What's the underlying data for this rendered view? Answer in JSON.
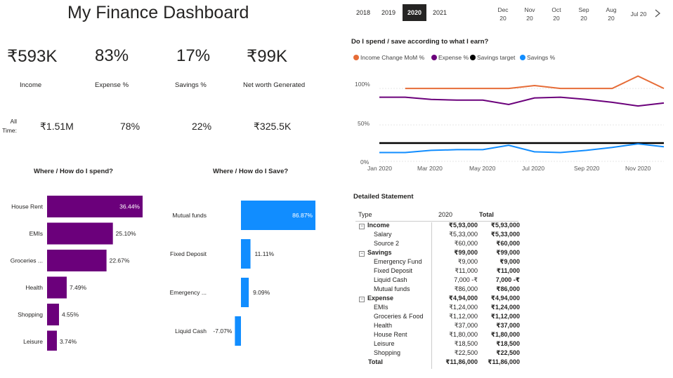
{
  "title": "My Finance Dashboard",
  "kpis": [
    {
      "value": "₹593K",
      "label": "Income",
      "all": "₹1.51M"
    },
    {
      "value": "83%",
      "label": "Expense %",
      "all": "78%"
    },
    {
      "value": "17%",
      "label": "Savings %",
      "all": "22%"
    },
    {
      "value": "₹99K",
      "label": "Net worth Generated",
      "all": "₹325.5K"
    }
  ],
  "all_time_label": "All Time:",
  "years": [
    "2018",
    "2019",
    "2020",
    "2021"
  ],
  "selected_year": "2020",
  "months": [
    {
      "m": "Dec",
      "y": "20"
    },
    {
      "m": "Nov",
      "y": "20"
    },
    {
      "m": "Oct",
      "y": "20"
    },
    {
      "m": "Sep",
      "y": "20"
    },
    {
      "m": "Aug",
      "y": "20"
    },
    {
      "m": "Jul 20",
      "y": ""
    }
  ],
  "chevron_icon": "chevron-right-icon",
  "spend_chart": {
    "title": "Where / How do I spend?",
    "color": "#6b007b"
  },
  "save_chart": {
    "title": "Where / How do I Save?",
    "color": "#118dff"
  },
  "line_chart": {
    "title": "Do I spend / save according to what I earn?",
    "legend": [
      {
        "name": "Income Change MoM %",
        "color": "#e66c37"
      },
      {
        "name": "Expense %",
        "color": "#6b007b"
      },
      {
        "name": "Savings target",
        "color": "#000000"
      },
      {
        "name": "Savings %",
        "color": "#118dff"
      }
    ],
    "y_ticks": [
      "100%",
      "50%",
      "0%"
    ],
    "x_ticks": [
      "Jan 2020",
      "Mar 2020",
      "May 2020",
      "Jul 2020",
      "Sep 2020",
      "Nov 2020"
    ]
  },
  "chart_data": [
    {
      "type": "bar",
      "title": "Where / How do I spend?",
      "categories": [
        "House Rent",
        "EMIs",
        "Groceries ...",
        "Health",
        "Shopping",
        "Leisure"
      ],
      "values": [
        36.44,
        25.1,
        22.67,
        7.49,
        4.55,
        3.74
      ],
      "labels": [
        "36.44%",
        "25.10%",
        "22.67%",
        "7.49%",
        "4.55%",
        "3.74%"
      ],
      "xlim": [
        0,
        36.44
      ]
    },
    {
      "type": "bar",
      "title": "Where / How do I Save?",
      "categories": [
        "Mutual funds",
        "Fixed Deposit",
        "Emergency ...",
        "Liquid Cash"
      ],
      "values": [
        86.87,
        11.11,
        9.09,
        -7.07
      ],
      "labels": [
        "86.87%",
        "11.11%",
        "9.09%",
        "-7.07%"
      ],
      "xlim": [
        -7.07,
        86.87
      ]
    },
    {
      "type": "line",
      "title": "Do I spend / save according to what I earn?",
      "x": [
        "Jan 2020",
        "Feb 2020",
        "Mar 2020",
        "Apr 2020",
        "May 2020",
        "Jun 2020",
        "Jul 2020",
        "Aug 2020",
        "Sep 2020",
        "Oct 2020",
        "Nov 2020",
        "Dec 2020"
      ],
      "ylim": [
        0,
        130
      ],
      "series": [
        {
          "name": "Income Change MoM %",
          "color": "#e66c37",
          "values": [
            null,
            100,
            100,
            100,
            100,
            100,
            104,
            100,
            100,
            100,
            117,
            100
          ]
        },
        {
          "name": "Expense %",
          "color": "#6b007b",
          "values": [
            88,
            88,
            85,
            84,
            84,
            78,
            87,
            88,
            85,
            81,
            76,
            80
          ]
        },
        {
          "name": "Savings target",
          "color": "#000000",
          "values": [
            25,
            25,
            25,
            25,
            25,
            25,
            25,
            25,
            25,
            25,
            25,
            25
          ]
        },
        {
          "name": "Savings %",
          "color": "#118dff",
          "values": [
            12,
            12,
            15,
            16,
            16,
            22,
            13,
            12,
            15,
            19,
            24,
            20
          ]
        }
      ]
    }
  ],
  "statement": {
    "title": "Detailed Statement",
    "headers": [
      "Type",
      "2020",
      "Total"
    ],
    "rows": [
      {
        "label": "Income",
        "level": 0,
        "v2020": "₹5,93,000",
        "total": "₹5,93,000"
      },
      {
        "label": "Salary",
        "level": 1,
        "v2020": "₹5,33,000",
        "total": "₹5,33,000"
      },
      {
        "label": "Source 2",
        "level": 1,
        "v2020": "₹60,000",
        "total": "₹60,000"
      },
      {
        "label": "Savings",
        "level": 0,
        "v2020": "₹99,000",
        "total": "₹99,000"
      },
      {
        "label": "Emergency Fund",
        "level": 1,
        "v2020": "₹9,000",
        "total": "₹9,000"
      },
      {
        "label": "Fixed Deposit",
        "level": 1,
        "v2020": "₹11,000",
        "total": "₹11,000"
      },
      {
        "label": "Liquid Cash",
        "level": 1,
        "v2020": "7,000 -₹",
        "total": "7,000 -₹"
      },
      {
        "label": "Mutual funds",
        "level": 1,
        "v2020": "₹86,000",
        "total": "₹86,000"
      },
      {
        "label": "Expense",
        "level": 0,
        "v2020": "₹4,94,000",
        "total": "₹4,94,000"
      },
      {
        "label": "EMIs",
        "level": 1,
        "v2020": "₹1,24,000",
        "total": "₹1,24,000"
      },
      {
        "label": "Groceries & Food",
        "level": 1,
        "v2020": "₹1,12,000",
        "total": "₹1,12,000"
      },
      {
        "label": "Health",
        "level": 1,
        "v2020": "₹37,000",
        "total": "₹37,000"
      },
      {
        "label": "House Rent",
        "level": 1,
        "v2020": "₹1,80,000",
        "total": "₹1,80,000"
      },
      {
        "label": "Leisure",
        "level": 1,
        "v2020": "₹18,500",
        "total": "₹18,500"
      },
      {
        "label": "Shopping",
        "level": 1,
        "v2020": "₹22,500",
        "total": "₹22,500"
      }
    ],
    "total": {
      "label": "Total",
      "v2020": "₹11,86,000",
      "total": "₹11,86,000"
    }
  }
}
